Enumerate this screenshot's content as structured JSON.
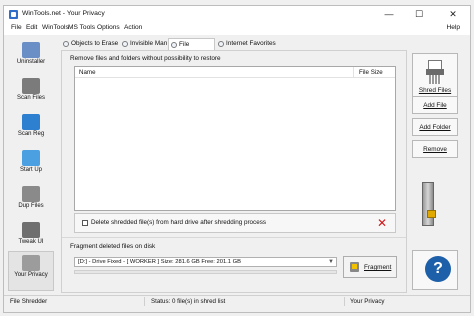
{
  "window": {
    "title": "WinTools.net - Your Privacy",
    "controls": {
      "minimize": "—",
      "maximize": "☐",
      "close": "✕"
    }
  },
  "menu": {
    "items": [
      "File",
      "Edit",
      "WinTools",
      "MS Tools",
      "Options",
      "Action"
    ],
    "help": "Help"
  },
  "left_toolbar": {
    "items": [
      {
        "label": "Uninstaller",
        "icon": "uninstaller-icon"
      },
      {
        "label": "Scan Files",
        "icon": "scan-files-icon"
      },
      {
        "label": "Scan Reg",
        "icon": "scan-reg-icon"
      },
      {
        "label": "Start Up",
        "icon": "startup-icon"
      },
      {
        "label": "Dup Files",
        "icon": "dup-files-icon"
      },
      {
        "label": "Tweak UI",
        "icon": "tweak-ui-icon"
      },
      {
        "label": "Your Privacy",
        "icon": "privacy-icon",
        "active": true
      }
    ]
  },
  "tabs": [
    {
      "label": "Objects to Erase"
    },
    {
      "label": "Invisible Man"
    },
    {
      "label": "File Shredder",
      "active": true
    },
    {
      "label": "Internet Favorites"
    }
  ],
  "shredder": {
    "group_label": "Remove files and folders without possibility to restore",
    "columns": {
      "name": "Name",
      "size": "File Size"
    },
    "rows": [],
    "delete_checkbox": {
      "label": "Delete shredded file(s) from hard drive after shredding process",
      "checked": false
    }
  },
  "fragment": {
    "group_label": "Fragment deleted files on disk",
    "drive_selected": "[D:] - Drive Fixed - [ WORKER ]  Size: 281.6 GB   Free: 201.1 GB",
    "button_label": "Fragment"
  },
  "right_panel": {
    "shred_files_label": "Shred Files",
    "add_file_label": "Add File",
    "add_folder_label": "Add Folder",
    "remove_label": "Remove",
    "help_glyph": "?"
  },
  "status": {
    "left": "File Shredder",
    "middle": "Status: 0 file(s) in shred list",
    "right": "Your Privacy"
  },
  "colors": {
    "accent": "#1d5fa8",
    "danger": "#d0191b"
  }
}
